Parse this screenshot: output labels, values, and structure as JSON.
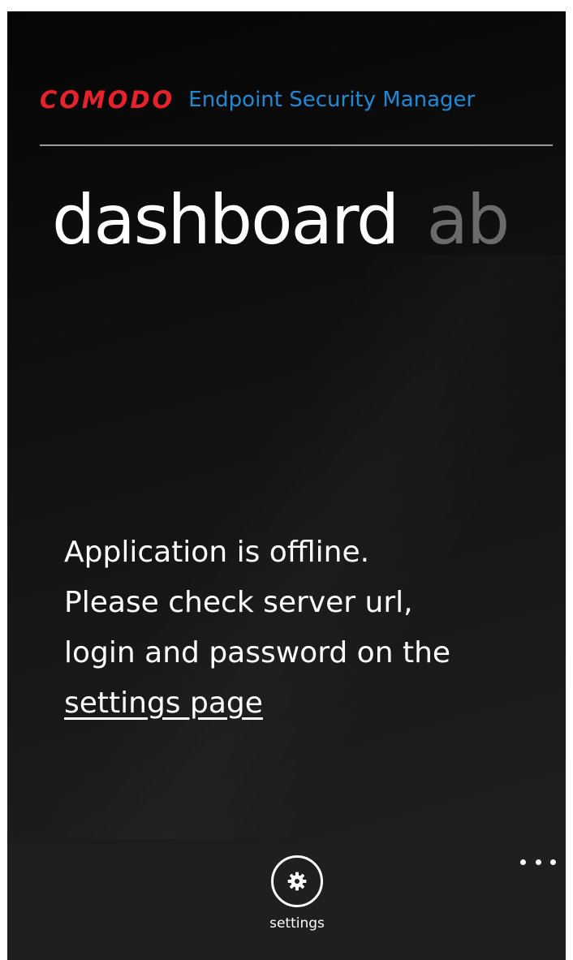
{
  "header": {
    "brand": "COMODO",
    "app_title": "Endpoint Security Manager"
  },
  "pivot": {
    "items": [
      {
        "label": "dashboard",
        "active": true
      },
      {
        "label": "ab",
        "active": false
      }
    ]
  },
  "message": {
    "line1": "Application is offline.",
    "line2": "Please check server url,",
    "line3": "login and password on the",
    "link": "settings page"
  },
  "app_bar": {
    "button_label": "settings",
    "button_icon": "gear-icon",
    "more_icon": "ellipsis-icon"
  },
  "colors": {
    "brand": "#e8212b",
    "accent": "#1e8ad6",
    "background": "#111111",
    "app_bar": "#1f1f1f"
  }
}
